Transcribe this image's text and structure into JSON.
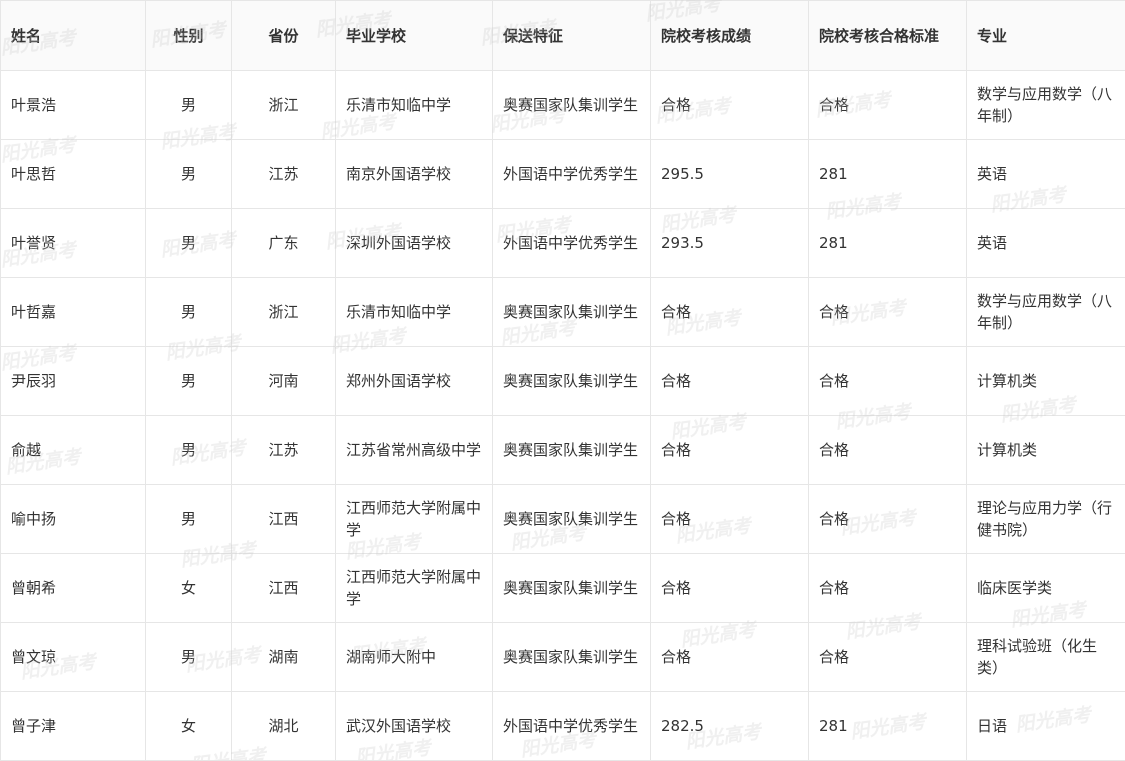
{
  "watermark": "阳光高考",
  "table": {
    "headers": [
      "姓名",
      "性别",
      "省份",
      "毕业学校",
      "保送特征",
      "院校考核成绩",
      "院校考核合格标准",
      "专业"
    ],
    "rows": [
      [
        "叶景浩",
        "男",
        "浙江",
        "乐清市知临中学",
        "奥赛国家队集训学生",
        "合格",
        "合格",
        "数学与应用数学（八年制）"
      ],
      [
        "叶思哲",
        "男",
        "江苏",
        "南京外国语学校",
        "外国语中学优秀学生",
        "295.5",
        "281",
        "英语"
      ],
      [
        "叶誉贤",
        "男",
        "广东",
        "深圳外国语学校",
        "外国语中学优秀学生",
        "293.5",
        "281",
        "英语"
      ],
      [
        "叶哲嘉",
        "男",
        "浙江",
        "乐清市知临中学",
        "奥赛国家队集训学生",
        "合格",
        "合格",
        "数学与应用数学（八年制）"
      ],
      [
        "尹辰羽",
        "男",
        "河南",
        "郑州外国语学校",
        "奥赛国家队集训学生",
        "合格",
        "合格",
        "计算机类"
      ],
      [
        "俞越",
        "男",
        "江苏",
        "江苏省常州高级中学",
        "奥赛国家队集训学生",
        "合格",
        "合格",
        "计算机类"
      ],
      [
        "喻中扬",
        "男",
        "江西",
        "江西师范大学附属中学",
        "奥赛国家队集训学生",
        "合格",
        "合格",
        "理论与应用力学（行健书院）"
      ],
      [
        "曾朝希",
        "女",
        "江西",
        "江西师范大学附属中学",
        "奥赛国家队集训学生",
        "合格",
        "合格",
        "临床医学类"
      ],
      [
        "曾文琼",
        "男",
        "湖南",
        "湖南师大附中",
        "奥赛国家队集训学生",
        "合格",
        "合格",
        "理科试验班（化生类）"
      ],
      [
        "曾子津",
        "女",
        "湖北",
        "武汉外国语学校",
        "外国语中学优秀学生",
        "282.5",
        "281",
        "日语"
      ]
    ]
  }
}
